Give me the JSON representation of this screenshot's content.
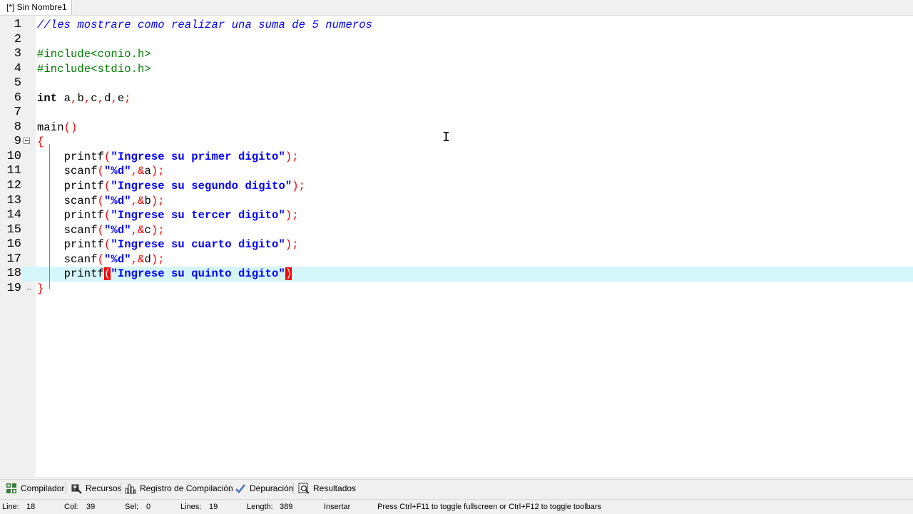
{
  "tab": {
    "title": "[*] Sin Nombre1"
  },
  "editor": {
    "current_line": 18,
    "lines": [
      {
        "n": "1",
        "segments": [
          {
            "t": "//les mostrare como realizar una suma de 5 numeros",
            "c": "cm"
          }
        ]
      },
      {
        "n": "2",
        "segments": []
      },
      {
        "n": "3",
        "segments": [
          {
            "t": "#include<conio.h>",
            "c": "pp"
          }
        ]
      },
      {
        "n": "4",
        "segments": [
          {
            "t": "#include<stdio.h>",
            "c": "pp"
          }
        ]
      },
      {
        "n": "5",
        "segments": []
      },
      {
        "n": "6",
        "segments": [
          {
            "t": "int",
            "c": "kw"
          },
          {
            "t": " a",
            "c": ""
          },
          {
            "t": ",",
            "c": "sy"
          },
          {
            "t": "b",
            "c": ""
          },
          {
            "t": ",",
            "c": "sy"
          },
          {
            "t": "c",
            "c": ""
          },
          {
            "t": ",",
            "c": "sy"
          },
          {
            "t": "d",
            "c": ""
          },
          {
            "t": ",",
            "c": "sy"
          },
          {
            "t": "e",
            "c": ""
          },
          {
            "t": ";",
            "c": "sy"
          }
        ]
      },
      {
        "n": "7",
        "segments": []
      },
      {
        "n": "8",
        "segments": [
          {
            "t": "main",
            "c": ""
          },
          {
            "t": "()",
            "c": "sy"
          }
        ]
      },
      {
        "n": "9",
        "segments": [
          {
            "t": "{",
            "c": "sy"
          }
        ]
      },
      {
        "n": "10",
        "segments": [
          {
            "t": "    printf",
            "c": ""
          },
          {
            "t": "(",
            "c": "sy"
          },
          {
            "t": "\"Ingrese su primer digito\"",
            "c": "st"
          },
          {
            "t": ");",
            "c": "sy"
          }
        ]
      },
      {
        "n": "11",
        "segments": [
          {
            "t": "    scanf",
            "c": ""
          },
          {
            "t": "(",
            "c": "sy"
          },
          {
            "t": "\"%d\"",
            "c": "st"
          },
          {
            "t": ",&",
            "c": "sy"
          },
          {
            "t": "a",
            "c": ""
          },
          {
            "t": ");",
            "c": "sy"
          }
        ]
      },
      {
        "n": "12",
        "segments": [
          {
            "t": "    printf",
            "c": ""
          },
          {
            "t": "(",
            "c": "sy"
          },
          {
            "t": "\"Ingrese su segundo digito\"",
            "c": "st"
          },
          {
            "t": ");",
            "c": "sy"
          }
        ]
      },
      {
        "n": "13",
        "segments": [
          {
            "t": "    scanf",
            "c": ""
          },
          {
            "t": "(",
            "c": "sy"
          },
          {
            "t": "\"%d\"",
            "c": "st"
          },
          {
            "t": ",&",
            "c": "sy"
          },
          {
            "t": "b",
            "c": ""
          },
          {
            "t": ");",
            "c": "sy"
          }
        ]
      },
      {
        "n": "14",
        "segments": [
          {
            "t": "    printf",
            "c": ""
          },
          {
            "t": "(",
            "c": "sy"
          },
          {
            "t": "\"Ingrese su tercer digito\"",
            "c": "st"
          },
          {
            "t": ");",
            "c": "sy"
          }
        ]
      },
      {
        "n": "15",
        "segments": [
          {
            "t": "    scanf",
            "c": ""
          },
          {
            "t": "(",
            "c": "sy"
          },
          {
            "t": "\"%d\"",
            "c": "st"
          },
          {
            "t": ",&",
            "c": "sy"
          },
          {
            "t": "c",
            "c": ""
          },
          {
            "t": ");",
            "c": "sy"
          }
        ]
      },
      {
        "n": "16",
        "segments": [
          {
            "t": "    printf",
            "c": ""
          },
          {
            "t": "(",
            "c": "sy"
          },
          {
            "t": "\"Ingrese su cuarto digito\"",
            "c": "st"
          },
          {
            "t": ");",
            "c": "sy"
          }
        ]
      },
      {
        "n": "17",
        "segments": [
          {
            "t": "    scanf",
            "c": ""
          },
          {
            "t": "(",
            "c": "sy"
          },
          {
            "t": "\"%d\"",
            "c": "st"
          },
          {
            "t": ",&",
            "c": "sy"
          },
          {
            "t": "d",
            "c": ""
          },
          {
            "t": ");",
            "c": "sy"
          }
        ]
      },
      {
        "n": "18",
        "segments": [
          {
            "t": "    printf",
            "c": ""
          },
          {
            "t": "(",
            "c": "hl"
          },
          {
            "t": "\"Ingrese su quinto digito\"",
            "c": "st"
          },
          {
            "t": ")",
            "c": "hl"
          }
        ]
      },
      {
        "n": "19",
        "segments": [
          {
            "t": "}",
            "c": "sy"
          }
        ]
      }
    ]
  },
  "bottom_tabs": [
    {
      "label": "Compilador",
      "icon": "compiler-grid-icon"
    },
    {
      "label": "Recursos",
      "icon": "resources-icon"
    },
    {
      "label": "Registro de Compilación",
      "icon": "bar-chart-icon"
    },
    {
      "label": "Depuración",
      "icon": "check-icon"
    },
    {
      "label": "Resultados",
      "icon": "magnifier-icon"
    }
  ],
  "status": {
    "line_label": "Line:",
    "line_value": "18",
    "col_label": "Col:",
    "col_value": "39",
    "sel_label": "Sel:",
    "sel_value": "0",
    "lines_label": "Lines:",
    "lines_value": "19",
    "length_label": "Length:",
    "length_value": "389",
    "mode": "Insertar",
    "hint": "Press Ctrl+F11 to toggle fullscreen or Ctrl+F12 to toggle toolbars"
  },
  "colors": {
    "comment": "#0000ff",
    "preprocessor": "#008000",
    "string": "#0000ff",
    "symbol": "#ff0000",
    "current_line": "#d4f6fb",
    "brace_match": "#ff0000"
  }
}
